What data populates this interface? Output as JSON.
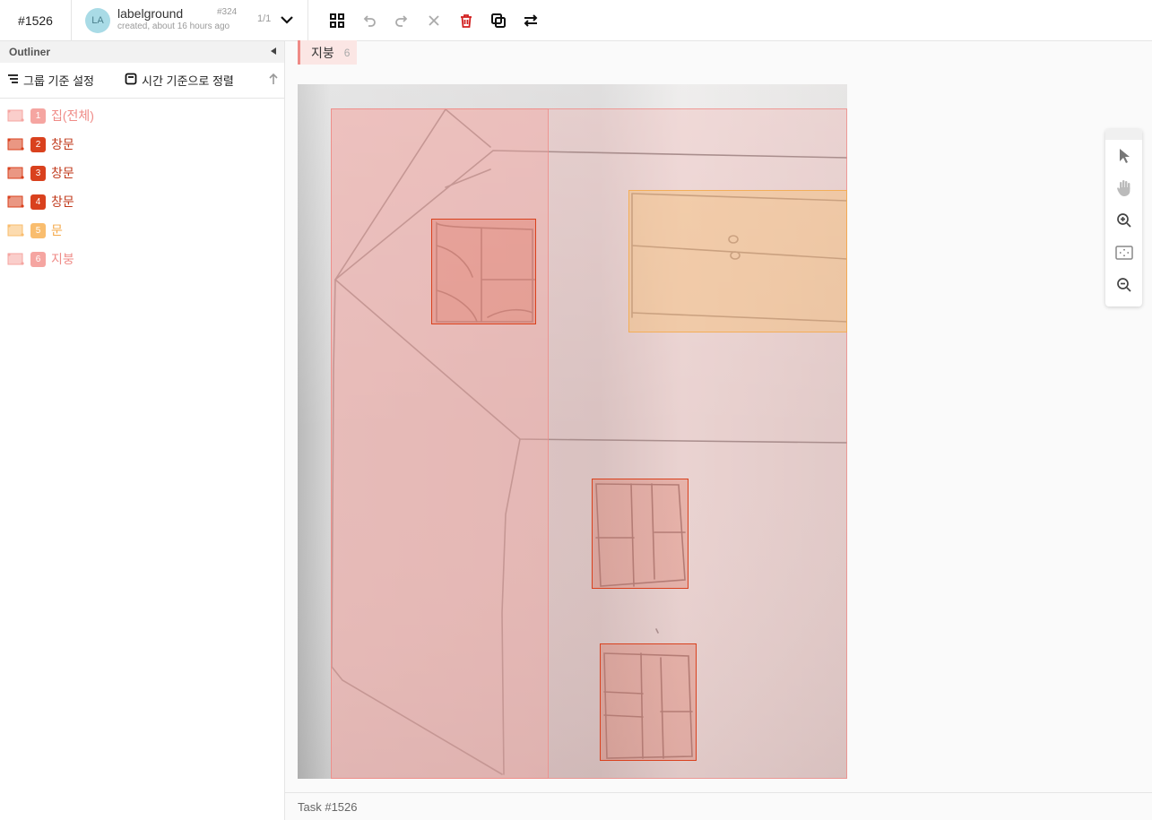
{
  "header": {
    "task_id": "#1526",
    "avatar_initials": "LA",
    "username": "labelground",
    "created": "created, about 16 hours ago",
    "annotation_id": "#324",
    "page_count": "1/1",
    "tools": [
      "grid-icon",
      "undo-icon",
      "redo-icon",
      "close-icon",
      "trash-icon",
      "copy-icon",
      "swap-icon"
    ]
  },
  "outliner": {
    "title": "Outliner",
    "group_label": "그룹 기준 설정",
    "sort_label": "시간 기준으로 정렬",
    "items": [
      {
        "index": "1",
        "label": "집(전체)",
        "color": "#f5a5a1",
        "text_color": "#ef8b87"
      },
      {
        "index": "2",
        "label": "창문",
        "color": "#d9411e",
        "text_color": "#c0391b"
      },
      {
        "index": "3",
        "label": "창문",
        "color": "#d9411e",
        "text_color": "#c0391b"
      },
      {
        "index": "4",
        "label": "창문",
        "color": "#d9411e",
        "text_color": "#c0391b"
      },
      {
        "index": "5",
        "label": "문",
        "color": "#f9bd6e",
        "text_color": "#f5a94a"
      },
      {
        "index": "6",
        "label": "지붕",
        "color": "#f5a5a1",
        "text_color": "#ef8b87"
      }
    ]
  },
  "selected_label": {
    "name": "지붕",
    "count": "6"
  },
  "zoom_tools": [
    "pointer-icon",
    "hand-icon",
    "zoom-in-icon",
    "fit-screen-icon",
    "zoom-out-icon"
  ],
  "footer": {
    "task": "Task #1526"
  }
}
